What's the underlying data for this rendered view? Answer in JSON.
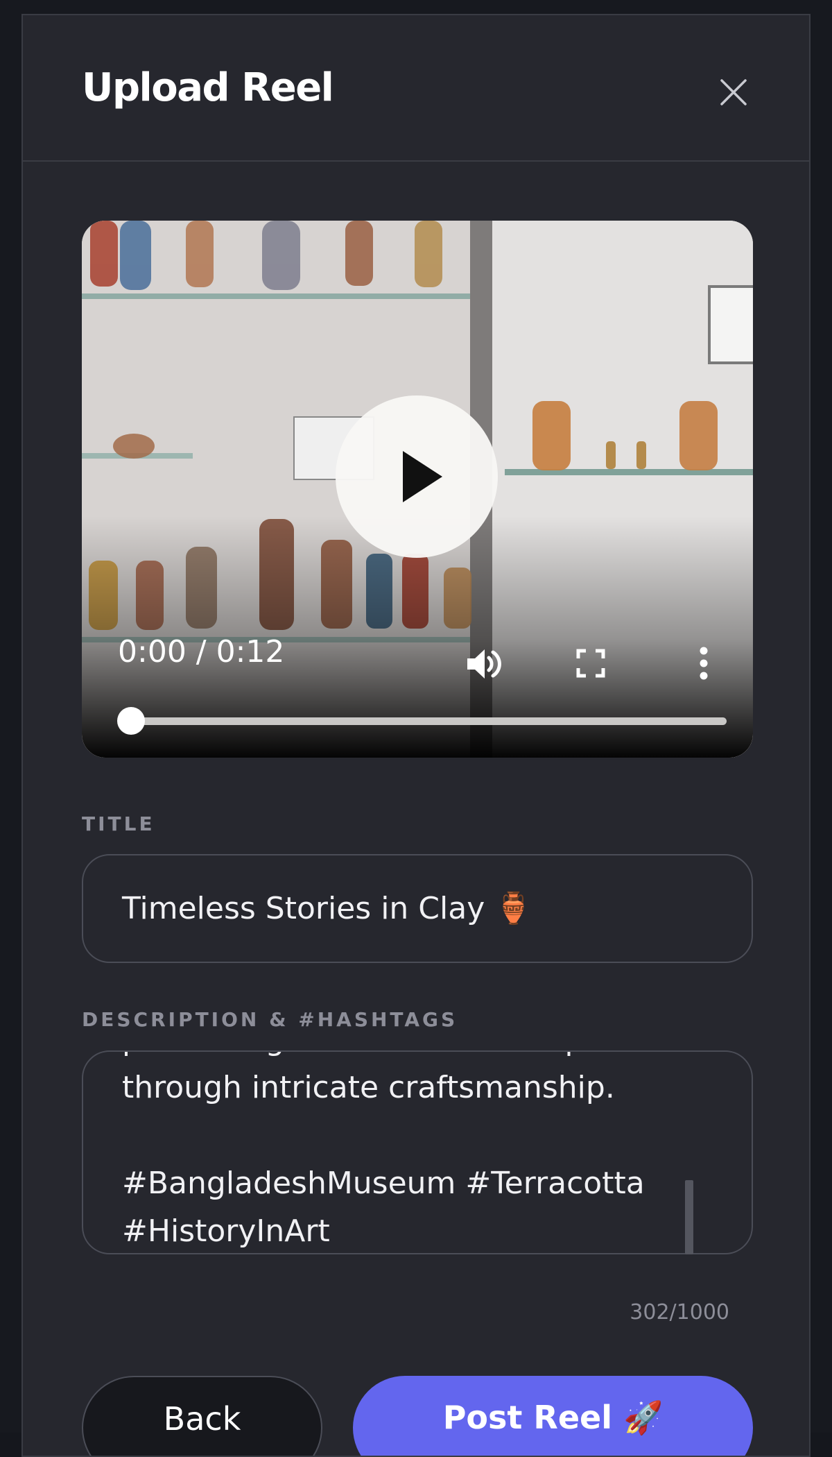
{
  "modal": {
    "title": "Upload Reel",
    "close_icon": "close-icon"
  },
  "video": {
    "time": "0:00 / 0:12",
    "progress": 0,
    "icons": [
      "play-icon",
      "volume-icon",
      "fullscreen-icon",
      "more-options-icon"
    ]
  },
  "title_field": {
    "label": "TITLE",
    "value": "Timeless Stories in Clay 🏺"
  },
  "description_field": {
    "label": "DESCRIPTION & #HASHTAGS",
    "value": "preserving the stories of the past\nthrough intricate craftsmanship.\n\n#BangladeshMuseum #Terracotta\n#HistoryInArt",
    "char_count": "302/1000"
  },
  "actions": {
    "back_label": "Back",
    "post_label": "Post Reel 🚀"
  },
  "colors": {
    "background": "#26272e",
    "accent": "#6366ee",
    "muted_label": "#8d8e99"
  }
}
